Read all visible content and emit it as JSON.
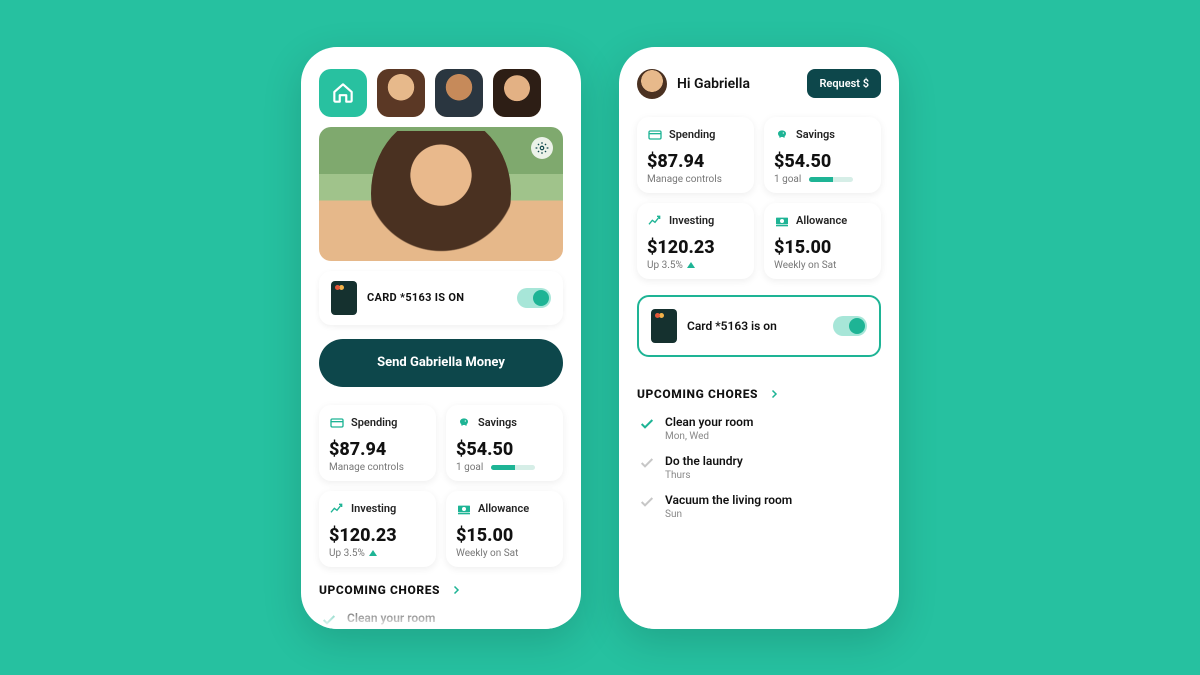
{
  "parent": {
    "card_status": "CARD *5163 IS ON",
    "send_label": "Send Gabriella Money",
    "tiles": {
      "spending": {
        "label": "Spending",
        "amount": "$87.94",
        "sub": "Manage controls"
      },
      "savings": {
        "label": "Savings",
        "amount": "$54.50",
        "sub": "1 goal"
      },
      "investing": {
        "label": "Investing",
        "amount": "$120.23",
        "sub": "Up 3.5%"
      },
      "allowance": {
        "label": "Allowance",
        "amount": "$15.00",
        "sub": "Weekly on Sat"
      }
    },
    "chores_heading": "UPCOMING CHORES",
    "chore0": {
      "title": "Clean your room"
    }
  },
  "child": {
    "greeting": "Hi Gabriella",
    "request_label": "Request $",
    "tiles": {
      "spending": {
        "label": "Spending",
        "amount": "$87.94",
        "sub": "Manage controls"
      },
      "savings": {
        "label": "Savings",
        "amount": "$54.50",
        "sub": "1 goal"
      },
      "investing": {
        "label": "Investing",
        "amount": "$120.23",
        "sub": "Up 3.5%"
      },
      "allowance": {
        "label": "Allowance",
        "amount": "$15.00",
        "sub": "Weekly on Sat"
      }
    },
    "card_status": "Card *5163 is on",
    "chores_heading": "UPCOMING CHORES",
    "chores": [
      {
        "title": "Clean your room",
        "days": "Mon, Wed",
        "done": true
      },
      {
        "title": "Do the laundry",
        "days": "Thurs",
        "done": false
      },
      {
        "title": "Vacuum the living room",
        "days": "Sun",
        "done": false
      }
    ]
  }
}
